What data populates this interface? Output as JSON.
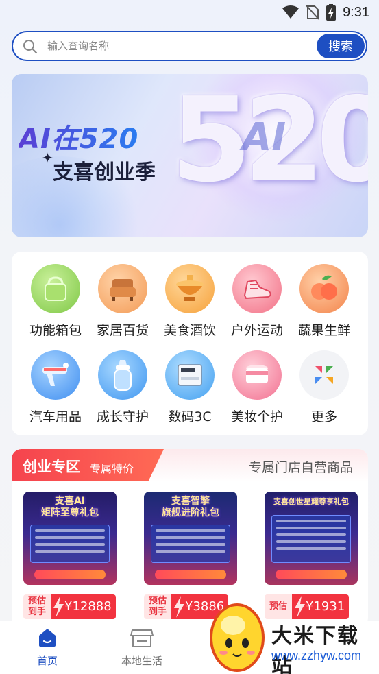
{
  "status_bar": {
    "time": "9:31",
    "icons": [
      "wifi-icon",
      "no-sim-icon",
      "battery-charging-icon"
    ]
  },
  "search": {
    "placeholder": "输入查询名称",
    "button_label": "搜索"
  },
  "banner": {
    "title": "AI在520",
    "subtitle": "支喜创业季",
    "big_text": "520",
    "overlay_text": "AI"
  },
  "categories": [
    {
      "label": "功能箱包",
      "icon": "bag-icon",
      "color": "#9ed86a"
    },
    {
      "label": "家居百货",
      "icon": "sofa-icon",
      "color": "#f6a35d"
    },
    {
      "label": "美食酒饮",
      "icon": "hotpot-icon",
      "color": "#f7a63b"
    },
    {
      "label": "户外运动",
      "icon": "sneaker-icon",
      "color": "#f57a8c"
    },
    {
      "label": "蔬果生鲜",
      "icon": "peach-icon",
      "color": "#f58a4a"
    },
    {
      "label": "汽车用品",
      "icon": "car-wash-icon",
      "color": "#4a9cf0"
    },
    {
      "label": "成长守护",
      "icon": "baby-bottle-icon",
      "color": "#4aa3f0"
    },
    {
      "label": "数码3C",
      "icon": "printer-icon",
      "color": "#4aa8f0"
    },
    {
      "label": "美妆个护",
      "icon": "cream-jar-icon",
      "color": "#f57a90"
    },
    {
      "label": "更多",
      "icon": "more-grid-icon",
      "color": "#f2f3f6"
    }
  ],
  "zone": {
    "title": "创业专区",
    "subtitle": "专属特价",
    "right_text": "专属门店自营商品",
    "products": [
      {
        "title_line1": "支喜AI",
        "title_line2": "矩阵至尊礼包",
        "price_label_1": "预估",
        "price_label_2": "到手",
        "price": "¥12888"
      },
      {
        "title_line1": "支喜智擎",
        "title_line2": "旗舰进阶礼包",
        "price_label_1": "预估",
        "price_label_2": "到手",
        "price": "¥3886"
      },
      {
        "title_line1": "支喜创世星耀尊享礼包",
        "title_line2": "",
        "price_label_1": "预估",
        "price_label_2": "",
        "price": "¥1931"
      }
    ]
  },
  "bottom_nav": [
    {
      "label": "首页",
      "icon": "home-icon",
      "active": true
    },
    {
      "label": "本地生活",
      "icon": "store-icon",
      "active": false
    }
  ],
  "watermark": {
    "text": "大米下载站",
    "url": "www.zzhyw.com"
  },
  "colors": {
    "primary": "#1e4fc2",
    "accent_red": "#f2333f"
  }
}
